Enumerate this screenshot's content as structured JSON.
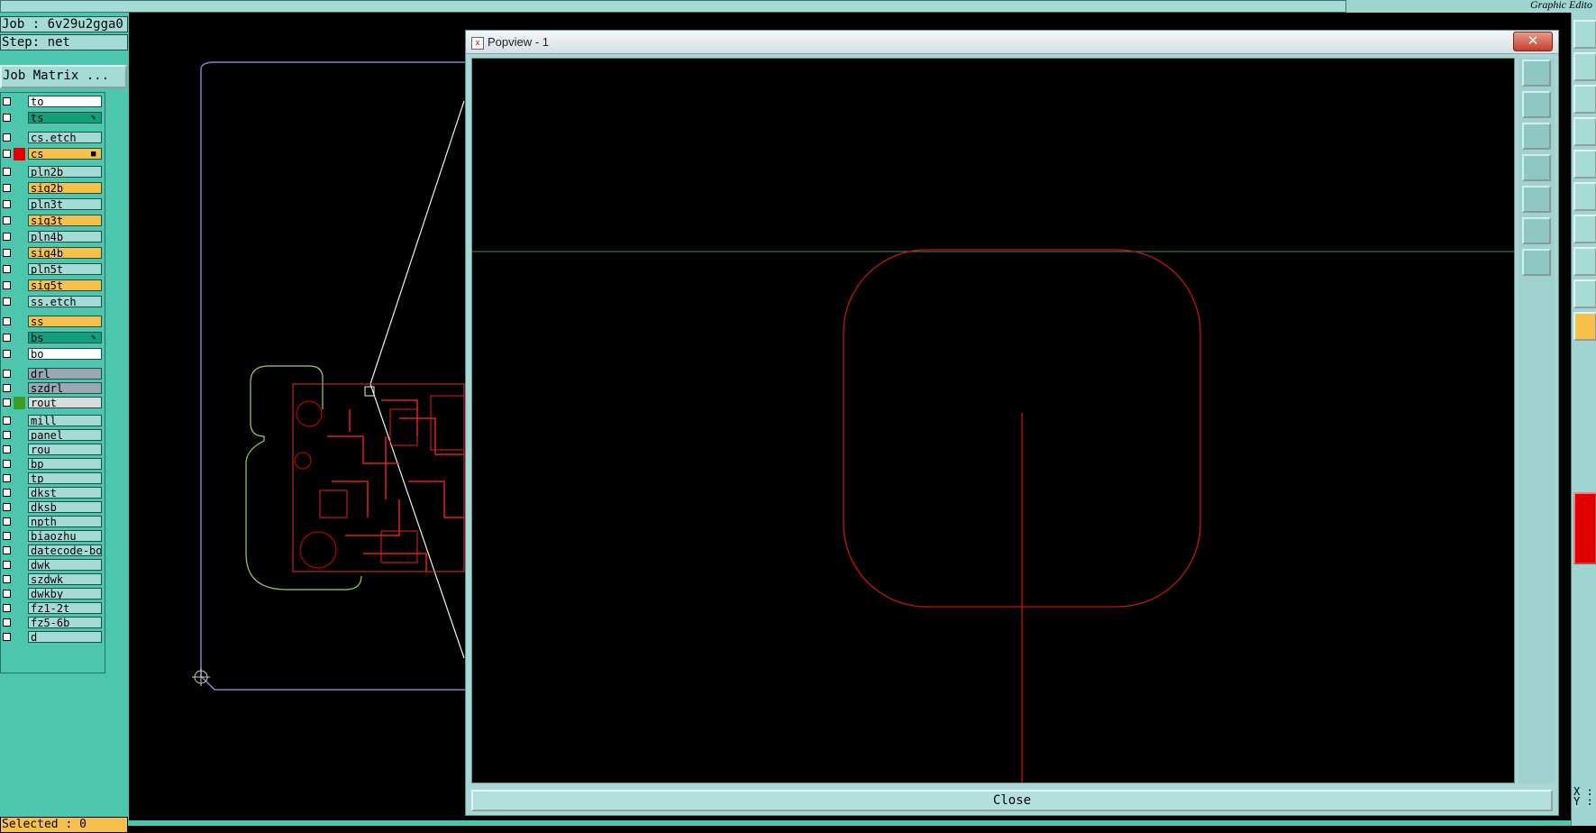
{
  "app": {
    "title": "Graphic Edito"
  },
  "job": {
    "label": "Job : 6v29u2gga0"
  },
  "step": {
    "label": "Step: net"
  },
  "job_matrix": {
    "label": "Job Matrix ..."
  },
  "layers": [
    {
      "name": "to",
      "color": "#ffffff",
      "mark": ""
    },
    {
      "name": "ts",
      "color": "#12a07a",
      "mark": "✎"
    },
    {
      "name": "cs.etch",
      "color": "#a4dbd5",
      "mark": ""
    },
    {
      "name": "cs",
      "color": "#f7c04a",
      "mark": "■"
    },
    {
      "name": "pln2b",
      "color": "#a4dbd5",
      "mark": ""
    },
    {
      "name": "sig2b",
      "color": "#f7c04a",
      "mark": ""
    },
    {
      "name": "pln3t",
      "color": "#a4dbd5",
      "mark": ""
    },
    {
      "name": "sig3t",
      "color": "#f7c04a",
      "mark": ""
    },
    {
      "name": "pln4b",
      "color": "#a4dbd5",
      "mark": ""
    },
    {
      "name": "sig4b",
      "color": "#f7c04a",
      "mark": ""
    },
    {
      "name": "pln5t",
      "color": "#a4dbd5",
      "mark": ""
    },
    {
      "name": "sig5t",
      "color": "#f7c04a",
      "mark": ""
    },
    {
      "name": "ss.etch",
      "color": "#a4dbd5",
      "mark": ""
    },
    {
      "name": "ss",
      "color": "#f7c04a",
      "mark": ""
    },
    {
      "name": "bs",
      "color": "#12a07a",
      "mark": "✎"
    },
    {
      "name": "bo",
      "color": "#ffffff",
      "mark": ""
    },
    {
      "name": "drl",
      "color": "#9aa8b4",
      "mark": ""
    },
    {
      "name": "szdrl",
      "color": "#9aa8b4",
      "mark": ""
    },
    {
      "name": "rout",
      "color": "#d8dcdc",
      "mark": ""
    },
    {
      "name": "mill",
      "color": "#a4dbd5",
      "mark": ""
    },
    {
      "name": "panel",
      "color": "#a4dbd5",
      "mark": ""
    },
    {
      "name": "rou",
      "color": "#a4dbd5",
      "mark": ""
    },
    {
      "name": "bp",
      "color": "#a4dbd5",
      "mark": ""
    },
    {
      "name": "tp",
      "color": "#a4dbd5",
      "mark": ""
    },
    {
      "name": "dkst",
      "color": "#a4dbd5",
      "mark": ""
    },
    {
      "name": "dksb",
      "color": "#a4dbd5",
      "mark": ""
    },
    {
      "name": "npth",
      "color": "#a4dbd5",
      "mark": ""
    },
    {
      "name": "biaozhu",
      "color": "#a4dbd5",
      "mark": ""
    },
    {
      "name": "datecode-bo",
      "color": "#a4dbd5",
      "mark": ""
    },
    {
      "name": "dwk",
      "color": "#a4dbd5",
      "mark": ""
    },
    {
      "name": "szdwk",
      "color": "#a4dbd5",
      "mark": ""
    },
    {
      "name": "dwkby",
      "color": "#a4dbd5",
      "mark": ""
    },
    {
      "name": "fz1-2t",
      "color": "#a4dbd5",
      "mark": ""
    },
    {
      "name": "fz5-6b",
      "color": "#a4dbd5",
      "mark": ""
    },
    {
      "name": "d",
      "color": "#a4dbd5",
      "mark": ""
    }
  ],
  "selected": {
    "label": "Selected : 0"
  },
  "popview": {
    "title": "Popview - 1",
    "close_x": "✕",
    "close_label": "Close"
  },
  "coords": {
    "x_label": "X :",
    "y_label": "Y :"
  },
  "colors": {
    "panel_bg": "#4cc6ad",
    "active_layer": "#f7c04a",
    "accent_red": "#e00000"
  }
}
